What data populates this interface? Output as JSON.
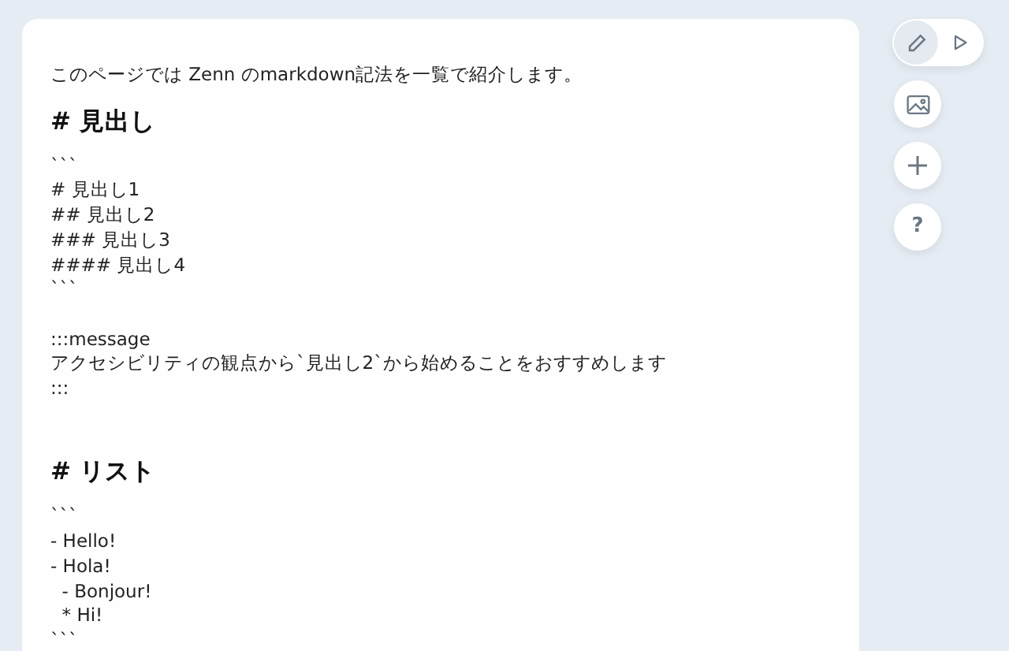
{
  "editor": {
    "lines": [
      {
        "kind": "text",
        "text": "このページでは Zenn のmarkdown記法を一覧で紹介します。"
      },
      {
        "kind": "heading",
        "text": "# 見出し"
      },
      {
        "kind": "text",
        "text": "```"
      },
      {
        "kind": "text",
        "text": "# 見出し1"
      },
      {
        "kind": "text",
        "text": "## 見出し2"
      },
      {
        "kind": "text",
        "text": "### 見出し3"
      },
      {
        "kind": "text",
        "text": "#### 見出し4"
      },
      {
        "kind": "text",
        "text": "```"
      },
      {
        "kind": "blank"
      },
      {
        "kind": "text",
        "text": ":::message"
      },
      {
        "kind": "text",
        "text": "アクセシビリティの観点から`見出し2`から始めることをおすすめします"
      },
      {
        "kind": "text",
        "text": ":::"
      },
      {
        "kind": "blank"
      },
      {
        "kind": "heading",
        "text": "# リスト"
      },
      {
        "kind": "text",
        "text": "```"
      },
      {
        "kind": "text",
        "text": "- Hello!"
      },
      {
        "kind": "text",
        "text": "- Hola!"
      },
      {
        "kind": "text",
        "text": "  - Bonjour!"
      },
      {
        "kind": "text",
        "text": "  * Hi!"
      },
      {
        "kind": "text",
        "text": "```"
      }
    ]
  },
  "toolbar": {
    "modes": [
      {
        "kind": "edit",
        "selected": true
      },
      {
        "kind": "preview",
        "selected": false
      }
    ],
    "buttons": [
      {
        "kind": "image"
      },
      {
        "kind": "add"
      },
      {
        "kind": "help",
        "text": "?"
      }
    ]
  }
}
